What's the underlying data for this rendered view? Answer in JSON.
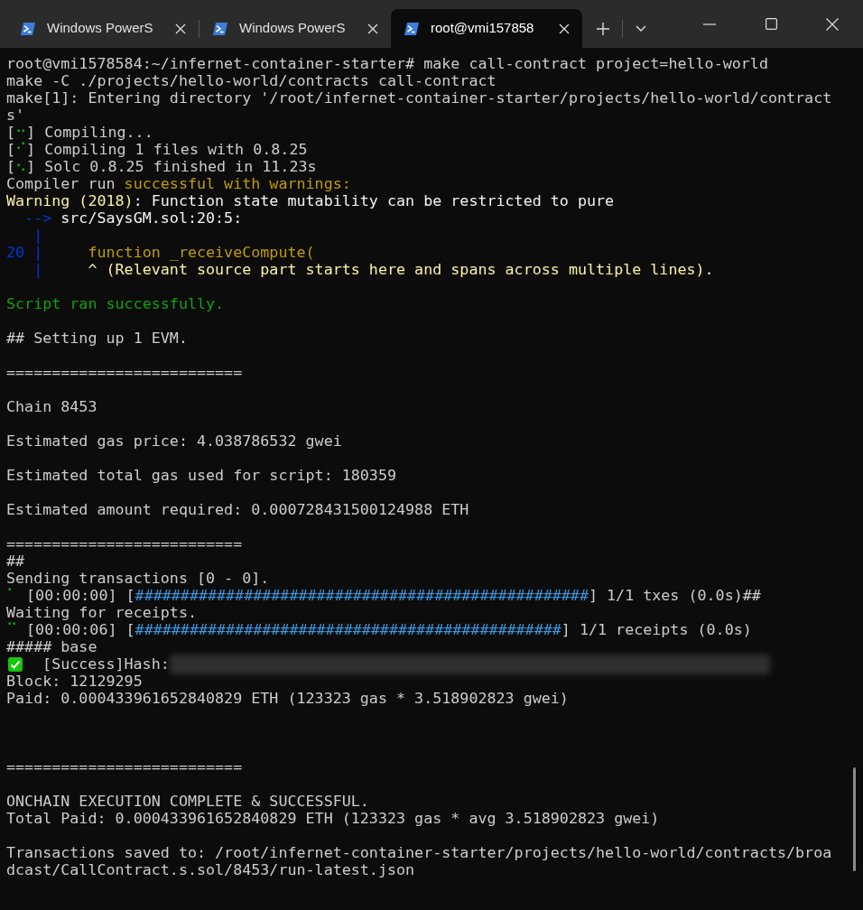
{
  "tabs": [
    {
      "title": "Windows PowerS",
      "selected": false
    },
    {
      "title": "Windows PowerS",
      "selected": false
    },
    {
      "title": "root@vmi157858",
      "selected": true
    }
  ],
  "terminal_lines": [
    {
      "segments": [
        {
          "text": "root@vmi1578584:~/infernet-container-starter# make call-contract project=hello-world",
          "kind": "default"
        }
      ]
    },
    {
      "segments": [
        {
          "text": "make -C ./projects/hello-world/contracts call-contract",
          "kind": "default"
        }
      ]
    },
    {
      "segments": [
        {
          "text": "make[1]: Entering directory '/root/infernet-container-starter/projects/hello-world/contract",
          "kind": "default"
        }
      ]
    },
    {
      "segments": [
        {
          "text": "s'",
          "kind": "default"
        }
      ]
    },
    {
      "segments": [
        {
          "text": "[",
          "kind": "default"
        },
        {
          "text": "⠒",
          "kind": "green"
        },
        {
          "text": "] Compiling...",
          "kind": "default"
        }
      ]
    },
    {
      "segments": [
        {
          "text": "[",
          "kind": "default"
        },
        {
          "text": "⠊",
          "kind": "green"
        },
        {
          "text": "] Compiling 1 files with 0.8.25",
          "kind": "default"
        }
      ]
    },
    {
      "segments": [
        {
          "text": "[",
          "kind": "default"
        },
        {
          "text": "⠢",
          "kind": "green"
        },
        {
          "text": "] Solc 0.8.25 finished in 11.23s",
          "kind": "default"
        }
      ]
    },
    {
      "segments": [
        {
          "text": "Compiler run ",
          "kind": "default"
        },
        {
          "text": "successful with warnings:",
          "kind": "yellow"
        }
      ]
    },
    {
      "segments": [
        {
          "text": "Warning (2018)",
          "kind": "lightyellow"
        },
        {
          "text": ": Function state mutability can be restricted to pure",
          "kind": "white"
        }
      ]
    },
    {
      "segments": [
        {
          "text": "  -->",
          "kind": "blue"
        },
        {
          "text": " src/SaysGM.sol:20:5:",
          "kind": "white"
        }
      ]
    },
    {
      "segments": [
        {
          "text": "   |",
          "kind": "blue"
        }
      ]
    },
    {
      "segments": [
        {
          "text": "20 |",
          "kind": "blue"
        },
        {
          "text": "     function _receiveCompute(",
          "kind": "yellow"
        }
      ]
    },
    {
      "segments": [
        {
          "text": "   |",
          "kind": "blue"
        },
        {
          "text": "     ^ (Relevant source part starts here and spans across multiple lines).",
          "kind": "lightyellow"
        }
      ]
    },
    {
      "kind": "blank"
    },
    {
      "segments": [
        {
          "text": "Script ran successfully.",
          "kind": "green"
        }
      ]
    },
    {
      "kind": "blank"
    },
    {
      "segments": [
        {
          "text": "## Setting up 1 EVM.",
          "kind": "default"
        }
      ]
    },
    {
      "kind": "blank"
    },
    {
      "segments": [
        {
          "text": "==========================",
          "kind": "default"
        }
      ]
    },
    {
      "kind": "blank"
    },
    {
      "segments": [
        {
          "text": "Chain 8453",
          "kind": "default"
        }
      ]
    },
    {
      "kind": "blank"
    },
    {
      "segments": [
        {
          "text": "Estimated gas price: 4.038786532 gwei",
          "kind": "default"
        }
      ]
    },
    {
      "kind": "blank"
    },
    {
      "segments": [
        {
          "text": "Estimated total gas used for script: 180359",
          "kind": "default"
        }
      ]
    },
    {
      "kind": "blank"
    },
    {
      "segments": [
        {
          "text": "Estimated amount required: 0.000728431500124988 ETH",
          "kind": "default"
        }
      ]
    },
    {
      "kind": "blank"
    },
    {
      "segments": [
        {
          "text": "==========================",
          "kind": "default"
        }
      ]
    },
    {
      "segments": [
        {
          "text": "##",
          "kind": "default"
        }
      ]
    },
    {
      "segments": [
        {
          "text": "Sending transactions [0 - 0].",
          "kind": "default"
        }
      ]
    },
    {
      "segments": [
        {
          "text": "⠁",
          "kind": "green"
        },
        {
          "text": " [00:00:00] [",
          "kind": "default"
        },
        {
          "text": "##################################################",
          "kind": "cyan"
        },
        {
          "text": "] 1/1 txes (0.0s)##",
          "kind": "default"
        }
      ]
    },
    {
      "segments": [
        {
          "text": "Waiting for receipts.",
          "kind": "default"
        }
      ]
    },
    {
      "segments": [
        {
          "text": "⠉",
          "kind": "green"
        },
        {
          "text": " [00:00:06] [",
          "kind": "default"
        },
        {
          "text": "###############################################",
          "kind": "cyan"
        },
        {
          "text": "] 1/1 receipts (0.0s)",
          "kind": "default"
        }
      ]
    },
    {
      "segments": [
        {
          "text": "##### base",
          "kind": "default"
        }
      ]
    },
    {
      "kind": "hash",
      "segments": [
        {
          "text": "  [Success]Hash:",
          "kind": "default"
        }
      ]
    },
    {
      "segments": [
        {
          "text": "Block: 12129295",
          "kind": "default"
        }
      ]
    },
    {
      "segments": [
        {
          "text": "Paid: 0.000433961652840829 ETH (123323 gas * 3.518902823 gwei)",
          "kind": "default"
        }
      ]
    },
    {
      "kind": "blank"
    },
    {
      "kind": "blank"
    },
    {
      "kind": "blank"
    },
    {
      "segments": [
        {
          "text": "==========================",
          "kind": "default"
        }
      ]
    },
    {
      "kind": "blank"
    },
    {
      "segments": [
        {
          "text": "ONCHAIN EXECUTION COMPLETE & SUCCESSFUL.",
          "kind": "default"
        }
      ]
    },
    {
      "segments": [
        {
          "text": "Total Paid: 0.000433961652840829 ETH (123323 gas * avg 3.518902823 gwei)",
          "kind": "default"
        }
      ]
    },
    {
      "kind": "blank"
    },
    {
      "segments": [
        {
          "text": "Transactions saved to: /root/infernet-container-starter/projects/hello-world/contracts/broa",
          "kind": "default"
        }
      ]
    },
    {
      "segments": [
        {
          "text": "dcast/CallContract.s.sol/8453/run-latest.json",
          "kind": "default"
        }
      ]
    }
  ]
}
